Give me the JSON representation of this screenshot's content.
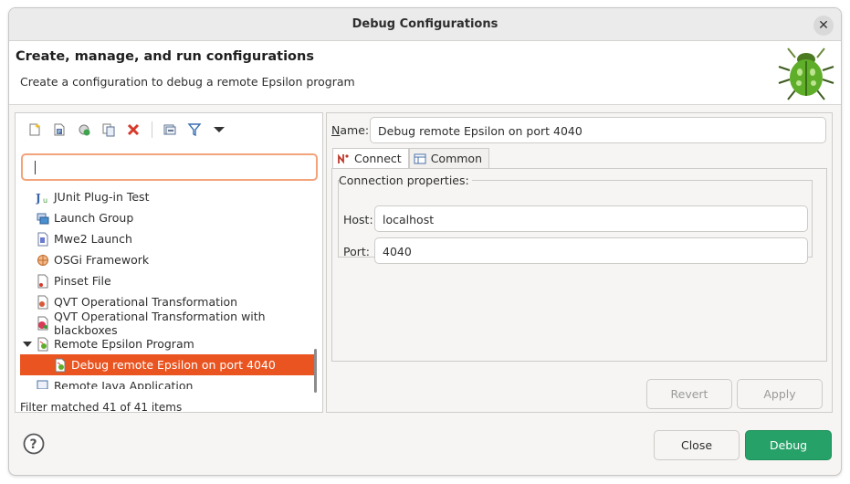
{
  "window": {
    "title": "Debug Configurations",
    "close_glyph": "✕"
  },
  "header": {
    "title": "Create, manage, and run configurations",
    "message": "Create a configuration to debug a remote Epsilon program",
    "image_icon": "bug-icon"
  },
  "toolbar": {
    "icons": [
      "new-config-icon",
      "new-prototype-icon",
      "export-icon",
      "duplicate-icon",
      "delete-icon",
      "collapse-all-icon",
      "filter-icon",
      "view-menu-icon"
    ]
  },
  "filter": {
    "value": "",
    "status": "Filter matched 41 of 41 items"
  },
  "tree": {
    "items": [
      {
        "label": "JUnit Plug-in Test",
        "icon": "junit-plugin-icon",
        "indent": 1
      },
      {
        "label": "Launch Group",
        "icon": "launch-group-icon",
        "indent": 1
      },
      {
        "label": "Mwe2 Launch",
        "icon": "mwe2-icon",
        "indent": 1
      },
      {
        "label": "OSGi Framework",
        "icon": "osgi-icon",
        "indent": 1
      },
      {
        "label": "Pinset File",
        "icon": "pinset-icon",
        "indent": 1
      },
      {
        "label": "QVT Operational Transformation",
        "icon": "qvt-icon",
        "indent": 1
      },
      {
        "label": "QVT Operational Transformation with blackboxes",
        "icon": "qvt-blackbox-icon",
        "indent": 1
      },
      {
        "label": "Remote Epsilon Program",
        "icon": "remote-epsilon-icon",
        "indent": 1,
        "expanded": true
      },
      {
        "label": "Debug remote Epsilon on port 4040",
        "icon": "epsilon-config-icon",
        "indent": 2,
        "selected": true
      },
      {
        "label": "Remote Java Application",
        "icon": "remote-java-icon",
        "indent": 1
      }
    ]
  },
  "config": {
    "name_label_mnemonic": "N",
    "name_label_rest": "ame:",
    "name_value": "Debug remote Epsilon on port 4040",
    "tabs": [
      {
        "label": "Connect",
        "icon": "connect-icon",
        "active": true
      },
      {
        "label": "Common",
        "icon": "common-icon",
        "active": false
      }
    ],
    "group_title": "Connection properties:",
    "host_label": "Host:",
    "host_value": "localhost",
    "port_label": "Port:",
    "port_value": "4040"
  },
  "buttons": {
    "revert": "Revert",
    "apply": "Apply",
    "close": "Close",
    "debug": "Debug"
  },
  "colors": {
    "selection": "#e95420",
    "primary": "#26a269",
    "focus": "#f3a37a"
  }
}
